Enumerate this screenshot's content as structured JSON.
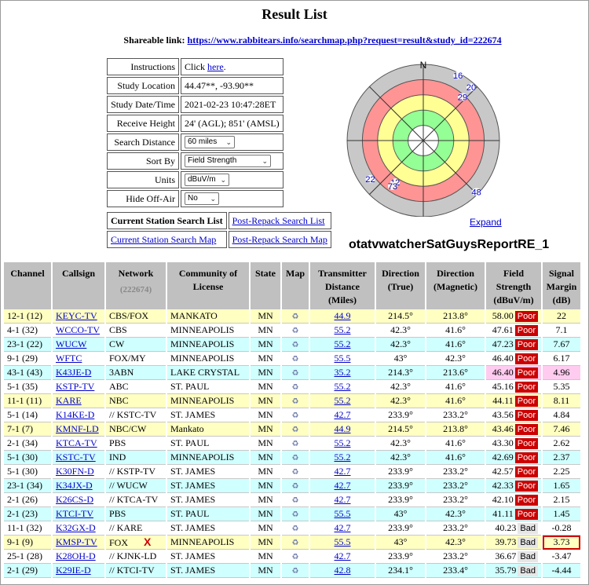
{
  "page": {
    "title": "Result List",
    "share_label": "Shareable link:",
    "share_url": "https://www.rabbitears.info/searchmap.php?request=result&study_id=222674"
  },
  "settings": {
    "instructions": {
      "label": "Instructions",
      "prefix": "Click ",
      "link": "here",
      "suffix": "."
    },
    "study_location": {
      "label": "Study Location",
      "value": "44.47**, -93.90**"
    },
    "study_datetime": {
      "label": "Study Date/Time",
      "value": "2021-02-23 10:47:28ET"
    },
    "receive_height": {
      "label": "Receive Height",
      "value": "24' (AGL); 851' (AMSL)"
    },
    "search_distance": {
      "label": "Search Distance",
      "selected": "60 miles"
    },
    "sort_by": {
      "label": "Sort By",
      "selected": "Field Strength"
    },
    "units": {
      "label": "Units",
      "selected": "dBuV/m"
    },
    "hide_off_air": {
      "label": "Hide Off-Air",
      "selected": "No"
    }
  },
  "links": {
    "current_list": "Current Station Search List",
    "post_repack_list": "Post-Repack Search List",
    "current_map": "Current Station Search Map",
    "post_repack_map": "Post-Repack Search Map"
  },
  "polar": {
    "north_label": "N",
    "expand_label": "Expand",
    "ring_colors": [
      "#c8c8c8",
      "#ff9494",
      "#ffff94",
      "#94ff94",
      "#ffffff"
    ],
    "markers": [
      {
        "label": "16",
        "bearing_deg": 28,
        "radius_frac": 0.97
      },
      {
        "label": "20",
        "bearing_deg": 42,
        "radius_frac": 0.94
      },
      {
        "label": "29",
        "bearing_deg": 42,
        "radius_frac": 0.77
      },
      {
        "label": "22",
        "bearing_deg": 234,
        "radius_frac": 0.86
      },
      {
        "label": "12",
        "bearing_deg": 214,
        "radius_frac": 0.66
      },
      {
        "label": "73",
        "bearing_deg": 214,
        "radius_frac": 0.72
      },
      {
        "label": "48",
        "bearing_deg": 134,
        "radius_frac": 0.97
      }
    ]
  },
  "report_name": "otatvwatcherSatGuysReportRE_1",
  "table": {
    "headers": {
      "channel": "Channel",
      "callsign": "Callsign",
      "network": "Network",
      "network_count": "(222674)",
      "community": "Community of License",
      "state": "State",
      "map": "Map",
      "distance": "Transmitter Distance (Miles)",
      "dir_true": "Direction (True)",
      "dir_mag": "Direction (Magnetic)",
      "field": "Field Strength (dBuV/m)",
      "margin": "Signal Margin (dB)"
    },
    "rows": [
      {
        "ch": "12-1 (12)",
        "call": "KEYC-TV",
        "net": "CBS/FOX",
        "city": "MANKATO",
        "st": "MN",
        "dist": "44.9",
        "tru": "214.5°",
        "mag": "213.8°",
        "fs": "58.00",
        "q": "Poor",
        "m": "22",
        "bg": "y"
      },
      {
        "ch": "4-1 (32)",
        "call": "WCCO-TV",
        "net": "CBS",
        "city": "MINNEAPOLIS",
        "st": "MN",
        "dist": "55.2",
        "tru": "42.3°",
        "mag": "41.6°",
        "fs": "47.61",
        "q": "Poor",
        "m": "7.1",
        "bg": "w"
      },
      {
        "ch": "23-1 (22)",
        "call": "WUCW",
        "net": "CW",
        "city": "MINNEAPOLIS",
        "st": "MN",
        "dist": "55.2",
        "tru": "42.3°",
        "mag": "41.6°",
        "fs": "47.23",
        "q": "Poor",
        "m": "7.67",
        "bg": "c"
      },
      {
        "ch": "9-1 (29)",
        "call": "WFTC",
        "net": "FOX/MY",
        "city": "MINNEAPOLIS",
        "st": "MN",
        "dist": "55.5",
        "tru": "43°",
        "mag": "42.3°",
        "fs": "46.40",
        "q": "Poor",
        "m": "6.17",
        "bg": "w"
      },
      {
        "ch": "43-1 (43)",
        "call": "K43JE-D",
        "net": "3ABN",
        "city": "LAKE CRYSTAL",
        "st": "MN",
        "dist": "35.2",
        "tru": "214.3°",
        "mag": "213.6°",
        "fs": "46.40",
        "q": "Poor",
        "m": "4.96",
        "bg": "c",
        "pink": true
      },
      {
        "ch": "5-1 (35)",
        "call": "KSTP-TV",
        "net": "ABC",
        "city": "ST. PAUL",
        "st": "MN",
        "dist": "55.2",
        "tru": "42.3°",
        "mag": "41.6°",
        "fs": "45.16",
        "q": "Poor",
        "m": "5.35",
        "bg": "w"
      },
      {
        "ch": "11-1 (11)",
        "call": "KARE",
        "net": "NBC",
        "city": "MINNEAPOLIS",
        "st": "MN",
        "dist": "55.2",
        "tru": "42.3°",
        "mag": "41.6°",
        "fs": "44.11",
        "q": "Poor",
        "m": "8.11",
        "bg": "y"
      },
      {
        "ch": "5-1 (14)",
        "call": "K14KE-D",
        "net": "// KSTC-TV",
        "city": "ST. JAMES",
        "st": "MN",
        "dist": "42.7",
        "tru": "233.9°",
        "mag": "233.2°",
        "fs": "43.56",
        "q": "Poor",
        "m": "4.84",
        "bg": "w"
      },
      {
        "ch": "7-1 (7)",
        "call": "KMNF-LD",
        "net": "NBC/CW",
        "city": "Mankato",
        "st": "MN",
        "dist": "44.9",
        "tru": "214.5°",
        "mag": "213.8°",
        "fs": "43.46",
        "q": "Poor",
        "m": "7.46",
        "bg": "y"
      },
      {
        "ch": "2-1 (34)",
        "call": "KTCA-TV",
        "net": "PBS",
        "city": "ST. PAUL",
        "st": "MN",
        "dist": "55.2",
        "tru": "42.3°",
        "mag": "41.6°",
        "fs": "43.30",
        "q": "Poor",
        "m": "2.62",
        "bg": "w"
      },
      {
        "ch": "5-1 (30)",
        "call": "KSTC-TV",
        "net": "IND",
        "city": "MINNEAPOLIS",
        "st": "MN",
        "dist": "55.2",
        "tru": "42.3°",
        "mag": "41.6°",
        "fs": "42.69",
        "q": "Poor",
        "m": "2.37",
        "bg": "c"
      },
      {
        "ch": "5-1 (30)",
        "call": "K30FN-D",
        "net": "// KSTP-TV",
        "city": "ST. JAMES",
        "st": "MN",
        "dist": "42.7",
        "tru": "233.9°",
        "mag": "233.2°",
        "fs": "42.57",
        "q": "Poor",
        "m": "2.25",
        "bg": "w"
      },
      {
        "ch": "23-1 (34)",
        "call": "K34JX-D",
        "net": "// WUCW",
        "city": "ST. JAMES",
        "st": "MN",
        "dist": "42.7",
        "tru": "233.9°",
        "mag": "233.2°",
        "fs": "42.33",
        "q": "Poor",
        "m": "1.65",
        "bg": "c"
      },
      {
        "ch": "2-1 (26)",
        "call": "K26CS-D",
        "net": "// KTCA-TV",
        "city": "ST. JAMES",
        "st": "MN",
        "dist": "42.7",
        "tru": "233.9°",
        "mag": "233.2°",
        "fs": "42.10",
        "q": "Poor",
        "m": "2.15",
        "bg": "w"
      },
      {
        "ch": "2-1 (23)",
        "call": "KTCI-TV",
        "net": "PBS",
        "city": "ST. PAUL",
        "st": "MN",
        "dist": "55.5",
        "tru": "43°",
        "mag": "42.3°",
        "fs": "41.11",
        "q": "Poor",
        "m": "1.45",
        "bg": "c"
      },
      {
        "ch": "11-1 (32)",
        "call": "K32GX-D",
        "net": "// KARE",
        "city": "ST. JAMES",
        "st": "MN",
        "dist": "42.7",
        "tru": "233.9°",
        "mag": "233.2°",
        "fs": "40.23",
        "q": "Bad",
        "m": "-0.28",
        "bg": "w"
      },
      {
        "ch": "9-1 (9)",
        "call": "KMSP-TV",
        "net": "FOX",
        "city": "MINNEAPOLIS",
        "st": "MN",
        "dist": "55.5",
        "tru": "43°",
        "mag": "42.3°",
        "fs": "39.73",
        "q": "Bad",
        "m": "3.73",
        "bg": "y",
        "xmark": "X",
        "boxed": true
      },
      {
        "ch": "25-1 (28)",
        "call": "K28OH-D",
        "net": "// KJNK-LD",
        "city": "ST. JAMES",
        "st": "MN",
        "dist": "42.7",
        "tru": "233.9°",
        "mag": "233.2°",
        "fs": "36.67",
        "q": "Bad",
        "m": "-3.47",
        "bg": "w"
      },
      {
        "ch": "2-1 (29)",
        "call": "K29IE-D",
        "net": "// KTCI-TV",
        "city": "ST. JAMES",
        "st": "MN",
        "dist": "42.8",
        "tru": "234.1°",
        "mag": "233.4°",
        "fs": "35.79",
        "q": "Bad",
        "m": "-4.44",
        "bg": "c"
      }
    ]
  }
}
